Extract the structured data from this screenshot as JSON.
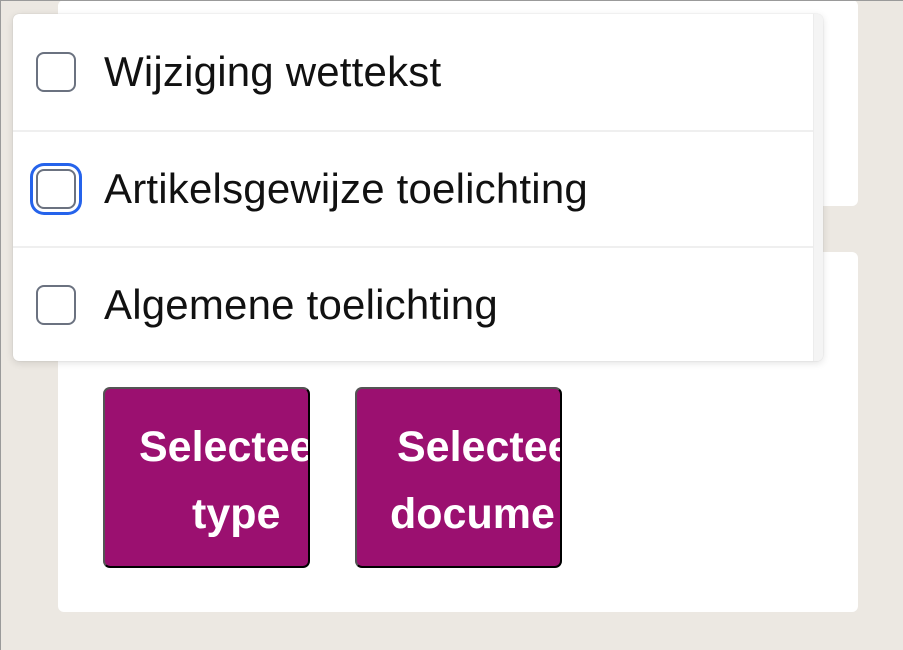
{
  "dropdown": {
    "options": [
      {
        "label": "Wijziging wettekst",
        "checked": false,
        "focused": false
      },
      {
        "label": "Artikelsgewijze toelichting",
        "checked": false,
        "focused": true
      },
      {
        "label": "Algemene toelichting",
        "checked": false,
        "focused": false
      }
    ]
  },
  "buttons": {
    "select_type": {
      "line1": "Selectee",
      "line2": "type"
    },
    "select_document": {
      "line1": "Selectee",
      "line2": "docume"
    }
  },
  "colors": {
    "background": "#ece8e2",
    "button": "#9b1070",
    "focus_ring": "#2563eb",
    "checkbox_border": "#6b7280"
  }
}
